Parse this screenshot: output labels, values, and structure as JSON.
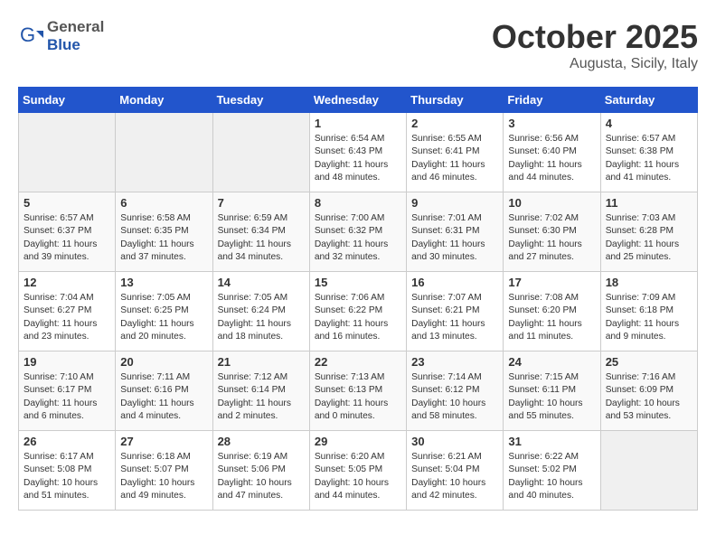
{
  "header": {
    "logo": {
      "general": "General",
      "blue": "Blue"
    },
    "month": "October 2025",
    "location": "Augusta, Sicily, Italy"
  },
  "weekdays": [
    "Sunday",
    "Monday",
    "Tuesday",
    "Wednesday",
    "Thursday",
    "Friday",
    "Saturday"
  ],
  "weeks": [
    [
      {
        "day": "",
        "info": ""
      },
      {
        "day": "",
        "info": ""
      },
      {
        "day": "",
        "info": ""
      },
      {
        "day": "1",
        "info": "Sunrise: 6:54 AM\nSunset: 6:43 PM\nDaylight: 11 hours\nand 48 minutes."
      },
      {
        "day": "2",
        "info": "Sunrise: 6:55 AM\nSunset: 6:41 PM\nDaylight: 11 hours\nand 46 minutes."
      },
      {
        "day": "3",
        "info": "Sunrise: 6:56 AM\nSunset: 6:40 PM\nDaylight: 11 hours\nand 44 minutes."
      },
      {
        "day": "4",
        "info": "Sunrise: 6:57 AM\nSunset: 6:38 PM\nDaylight: 11 hours\nand 41 minutes."
      }
    ],
    [
      {
        "day": "5",
        "info": "Sunrise: 6:57 AM\nSunset: 6:37 PM\nDaylight: 11 hours\nand 39 minutes."
      },
      {
        "day": "6",
        "info": "Sunrise: 6:58 AM\nSunset: 6:35 PM\nDaylight: 11 hours\nand 37 minutes."
      },
      {
        "day": "7",
        "info": "Sunrise: 6:59 AM\nSunset: 6:34 PM\nDaylight: 11 hours\nand 34 minutes."
      },
      {
        "day": "8",
        "info": "Sunrise: 7:00 AM\nSunset: 6:32 PM\nDaylight: 11 hours\nand 32 minutes."
      },
      {
        "day": "9",
        "info": "Sunrise: 7:01 AM\nSunset: 6:31 PM\nDaylight: 11 hours\nand 30 minutes."
      },
      {
        "day": "10",
        "info": "Sunrise: 7:02 AM\nSunset: 6:30 PM\nDaylight: 11 hours\nand 27 minutes."
      },
      {
        "day": "11",
        "info": "Sunrise: 7:03 AM\nSunset: 6:28 PM\nDaylight: 11 hours\nand 25 minutes."
      }
    ],
    [
      {
        "day": "12",
        "info": "Sunrise: 7:04 AM\nSunset: 6:27 PM\nDaylight: 11 hours\nand 23 minutes."
      },
      {
        "day": "13",
        "info": "Sunrise: 7:05 AM\nSunset: 6:25 PM\nDaylight: 11 hours\nand 20 minutes."
      },
      {
        "day": "14",
        "info": "Sunrise: 7:05 AM\nSunset: 6:24 PM\nDaylight: 11 hours\nand 18 minutes."
      },
      {
        "day": "15",
        "info": "Sunrise: 7:06 AM\nSunset: 6:22 PM\nDaylight: 11 hours\nand 16 minutes."
      },
      {
        "day": "16",
        "info": "Sunrise: 7:07 AM\nSunset: 6:21 PM\nDaylight: 11 hours\nand 13 minutes."
      },
      {
        "day": "17",
        "info": "Sunrise: 7:08 AM\nSunset: 6:20 PM\nDaylight: 11 hours\nand 11 minutes."
      },
      {
        "day": "18",
        "info": "Sunrise: 7:09 AM\nSunset: 6:18 PM\nDaylight: 11 hours\nand 9 minutes."
      }
    ],
    [
      {
        "day": "19",
        "info": "Sunrise: 7:10 AM\nSunset: 6:17 PM\nDaylight: 11 hours\nand 6 minutes."
      },
      {
        "day": "20",
        "info": "Sunrise: 7:11 AM\nSunset: 6:16 PM\nDaylight: 11 hours\nand 4 minutes."
      },
      {
        "day": "21",
        "info": "Sunrise: 7:12 AM\nSunset: 6:14 PM\nDaylight: 11 hours\nand 2 minutes."
      },
      {
        "day": "22",
        "info": "Sunrise: 7:13 AM\nSunset: 6:13 PM\nDaylight: 11 hours\nand 0 minutes."
      },
      {
        "day": "23",
        "info": "Sunrise: 7:14 AM\nSunset: 6:12 PM\nDaylight: 10 hours\nand 58 minutes."
      },
      {
        "day": "24",
        "info": "Sunrise: 7:15 AM\nSunset: 6:11 PM\nDaylight: 10 hours\nand 55 minutes."
      },
      {
        "day": "25",
        "info": "Sunrise: 7:16 AM\nSunset: 6:09 PM\nDaylight: 10 hours\nand 53 minutes."
      }
    ],
    [
      {
        "day": "26",
        "info": "Sunrise: 6:17 AM\nSunset: 5:08 PM\nDaylight: 10 hours\nand 51 minutes."
      },
      {
        "day": "27",
        "info": "Sunrise: 6:18 AM\nSunset: 5:07 PM\nDaylight: 10 hours\nand 49 minutes."
      },
      {
        "day": "28",
        "info": "Sunrise: 6:19 AM\nSunset: 5:06 PM\nDaylight: 10 hours\nand 47 minutes."
      },
      {
        "day": "29",
        "info": "Sunrise: 6:20 AM\nSunset: 5:05 PM\nDaylight: 10 hours\nand 44 minutes."
      },
      {
        "day": "30",
        "info": "Sunrise: 6:21 AM\nSunset: 5:04 PM\nDaylight: 10 hours\nand 42 minutes."
      },
      {
        "day": "31",
        "info": "Sunrise: 6:22 AM\nSunset: 5:02 PM\nDaylight: 10 hours\nand 40 minutes."
      },
      {
        "day": "",
        "info": ""
      }
    ]
  ]
}
